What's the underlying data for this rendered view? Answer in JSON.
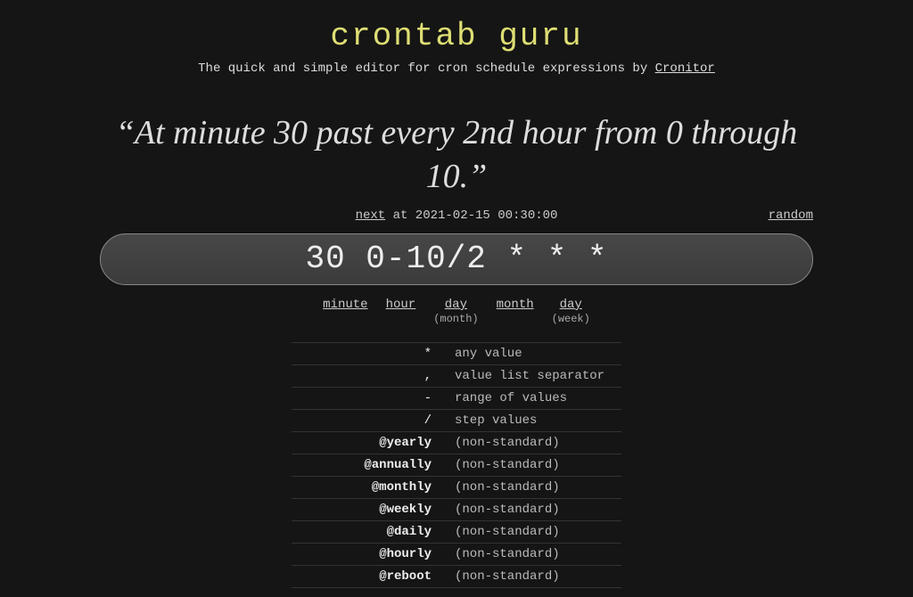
{
  "header": {
    "title": "crontab guru",
    "subtitle_pre": "The quick and simple editor for cron schedule expressions by ",
    "subtitle_link": "Cronitor"
  },
  "description": "“At minute 30 past every 2nd hour from 0 through 10.”",
  "next_label": "next",
  "next_at": " at 2021-02-15 00:30:00",
  "random_label": "random",
  "cron_expression": "30 0-10/2 * * *",
  "fields": [
    {
      "label": "minute",
      "sub": ""
    },
    {
      "label": "hour",
      "sub": ""
    },
    {
      "label": "day",
      "sub": "(month)"
    },
    {
      "label": "month",
      "sub": ""
    },
    {
      "label": "day",
      "sub": "(week)"
    }
  ],
  "legend": [
    {
      "sym": "*",
      "desc": "any value",
      "bold": false
    },
    {
      "sym": ",",
      "desc": "value list separator",
      "bold": false
    },
    {
      "sym": "-",
      "desc": "range of values",
      "bold": false
    },
    {
      "sym": "/",
      "desc": "step values",
      "bold": false
    },
    {
      "sym": "@yearly",
      "desc": "(non-standard)",
      "bold": true
    },
    {
      "sym": "@annually",
      "desc": "(non-standard)",
      "bold": true
    },
    {
      "sym": "@monthly",
      "desc": "(non-standard)",
      "bold": true
    },
    {
      "sym": "@weekly",
      "desc": "(non-standard)",
      "bold": true
    },
    {
      "sym": "@daily",
      "desc": "(non-standard)",
      "bold": true
    },
    {
      "sym": "@hourly",
      "desc": "(non-standard)",
      "bold": true
    },
    {
      "sym": "@reboot",
      "desc": "(non-standard)",
      "bold": true
    }
  ]
}
